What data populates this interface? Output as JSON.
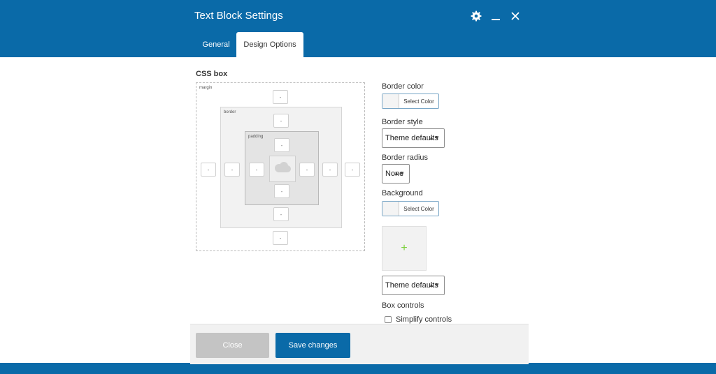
{
  "header": {
    "title": "Text Block Settings",
    "icons": [
      "gear-icon",
      "minimize-icon",
      "close-icon"
    ]
  },
  "tabs": [
    {
      "label": "General",
      "active": false
    },
    {
      "label": "Design Options",
      "active": true
    }
  ],
  "css_box": {
    "title": "CSS box",
    "margin_label": "margin",
    "border_label": "border",
    "padding_label": "padding",
    "field_placeholder": "-",
    "content_icon": "cloud-icon"
  },
  "border_color": {
    "label": "Border color",
    "button_label": "Select Color"
  },
  "border_style": {
    "label": "Border style",
    "value": "Theme defaults"
  },
  "border_radius": {
    "label": "Border radius",
    "value": "None"
  },
  "background": {
    "label": "Background",
    "button_label": "Select Color",
    "image_icon": "plus-icon",
    "style_value": "Theme defaults"
  },
  "box_controls": {
    "label": "Box controls",
    "checkbox_label": "Simplify controls",
    "checked": false
  },
  "footer": {
    "close_label": "Close",
    "save_label": "Save changes"
  },
  "colors": {
    "brand": "#0a6aa8",
    "close_button": "#c4c4c4",
    "plus": "#7ad03a"
  }
}
